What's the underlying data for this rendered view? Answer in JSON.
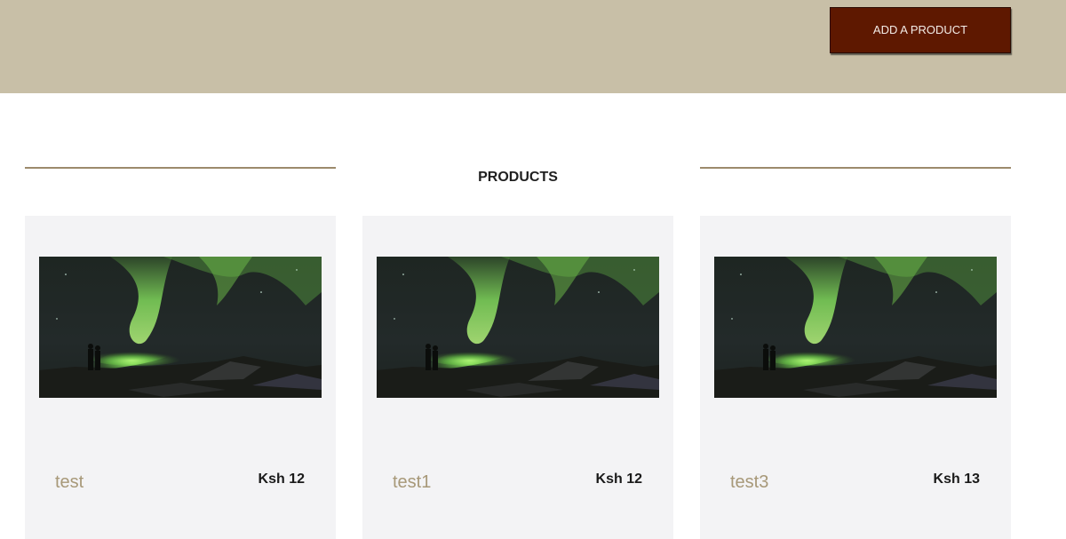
{
  "header": {
    "add_button_label": "ADD A PRODUCT"
  },
  "section": {
    "title": "PRODUCTS"
  },
  "products": [
    {
      "name": "test",
      "price": "Ksh 12"
    },
    {
      "name": "test1",
      "price": "Ksh 12"
    },
    {
      "name": "test3",
      "price": "Ksh 13"
    }
  ],
  "colors": {
    "header_bg": "#c8bfa7",
    "button_bg": "#5e1800",
    "divider": "#9c8a6c",
    "card_bg": "#f3f3f5",
    "product_name": "#a79878"
  }
}
